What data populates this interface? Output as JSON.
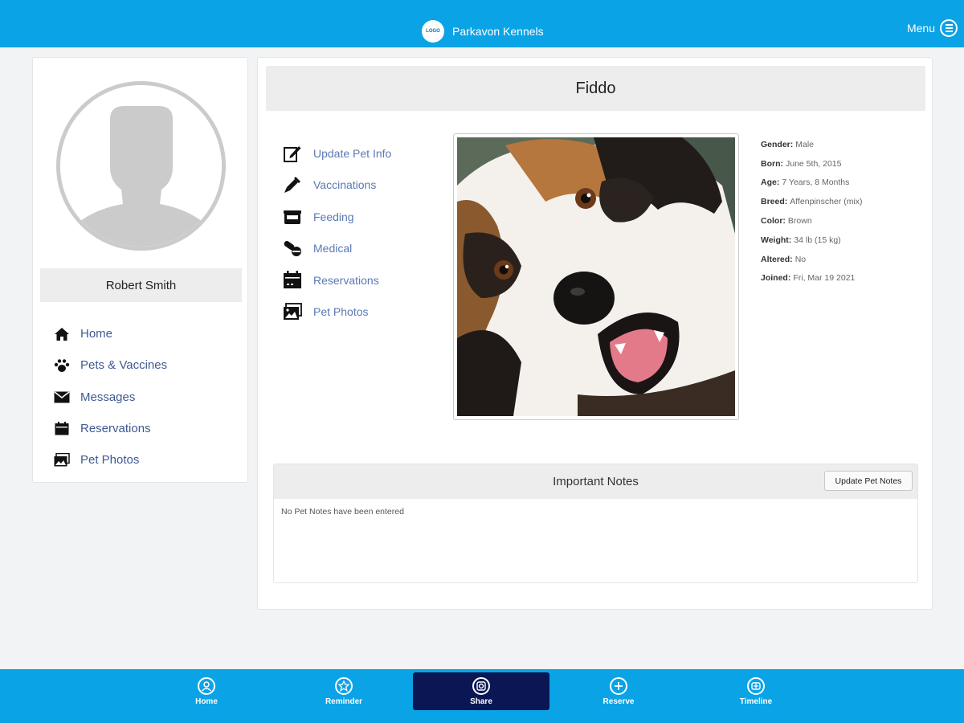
{
  "header": {
    "logo_text": "LOGO",
    "app_name": "Parkavon Kennels",
    "menu_label": "Menu"
  },
  "profile": {
    "user_name": "Robert Smith",
    "nav": [
      {
        "label": "Home",
        "icon": "home-icon"
      },
      {
        "label": "Pets & Vaccines",
        "icon": "paw-icon"
      },
      {
        "label": "Messages",
        "icon": "envelope-icon"
      },
      {
        "label": "Reservations",
        "icon": "calendar-icon"
      },
      {
        "label": "Pet Photos",
        "icon": "photos-icon"
      }
    ]
  },
  "pet": {
    "name": "Fiddo",
    "actions": [
      {
        "label": "Update Pet Info",
        "icon": "edit-icon"
      },
      {
        "label": "Vaccinations",
        "icon": "syringe-icon"
      },
      {
        "label": "Feeding",
        "icon": "food-bowl-icon"
      },
      {
        "label": "Medical",
        "icon": "pills-icon"
      },
      {
        "label": "Reservations",
        "icon": "calendar-icon"
      },
      {
        "label": "Pet Photos",
        "icon": "photos-icon"
      }
    ],
    "details": [
      {
        "key": "Gender:",
        "value": "Male"
      },
      {
        "key": "Born:",
        "value": "June 5th, 2015"
      },
      {
        "key": "Age:",
        "value": "7 Years, 8 Months"
      },
      {
        "key": "Breed:",
        "value": "Affenpinscher (mix)"
      },
      {
        "key": "Color:",
        "value": "Brown"
      },
      {
        "key": "Weight:",
        "value": "34 lb (15 kg)"
      },
      {
        "key": "Altered:",
        "value": "No"
      },
      {
        "key": "Joined:",
        "value": "Fri, Mar 19 2021"
      }
    ]
  },
  "notes": {
    "title": "Important Notes",
    "button_label": "Update Pet Notes",
    "empty_text": "No Pet Notes have been entered"
  },
  "tabbar": {
    "active_index": 2,
    "tabs": [
      {
        "label": "Home",
        "icon": "user-circle-icon"
      },
      {
        "label": "Reminder",
        "icon": "star-icon"
      },
      {
        "label": "Share",
        "icon": "camera-icon"
      },
      {
        "label": "Reserve",
        "icon": "plus-icon"
      },
      {
        "label": "Timeline",
        "icon": "timeline-icon"
      }
    ]
  },
  "colors": {
    "primary_blue": "#0aa3e6",
    "active_tab": "#0a1754",
    "link_blue": "#3e5a93"
  }
}
